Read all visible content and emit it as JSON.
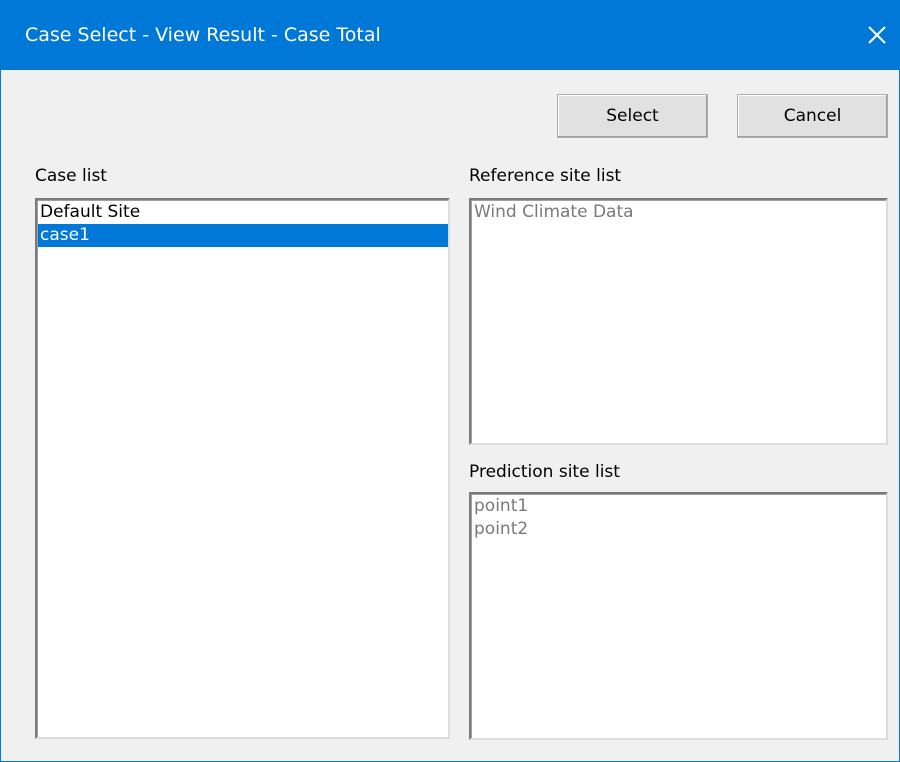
{
  "window": {
    "title": "Case Select - View Result - Case Total",
    "accent_color": "#0078d7",
    "close_icon": "close-icon"
  },
  "buttons": {
    "select_label": "Select",
    "cancel_label": "Cancel"
  },
  "case_list": {
    "label": "Case list",
    "items": [
      "Default Site",
      "case1"
    ],
    "selected": "case1"
  },
  "reference_site_list": {
    "label": "Reference site list",
    "items": [
      "Wind Climate Data"
    ]
  },
  "prediction_site_list": {
    "label": "Prediction site list",
    "items": [
      "point1",
      "point2"
    ]
  }
}
